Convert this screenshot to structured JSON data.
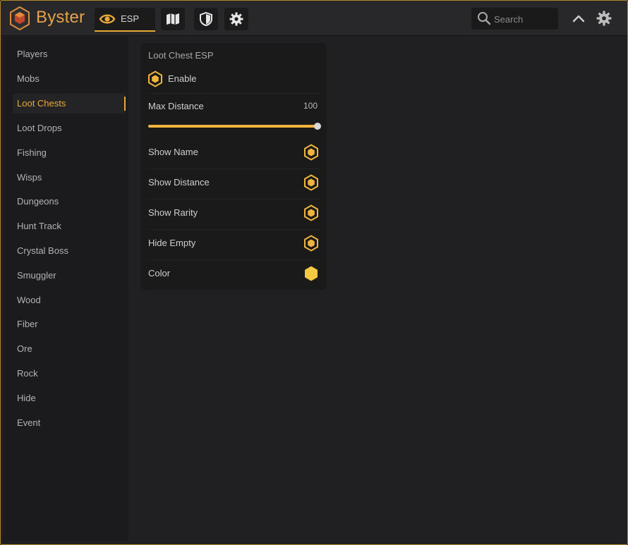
{
  "header": {
    "brand": "Byster",
    "tabs": {
      "esp": "ESP"
    },
    "search": {
      "placeholder": "Search",
      "value": ""
    }
  },
  "sidebar": {
    "items": [
      {
        "label": "Players",
        "active": false
      },
      {
        "label": "Mobs",
        "active": false
      },
      {
        "label": "Loot Chests",
        "active": true
      },
      {
        "label": "Loot Drops",
        "active": false
      },
      {
        "label": "Fishing",
        "active": false
      },
      {
        "label": "Wisps",
        "active": false
      },
      {
        "label": "Dungeons",
        "active": false
      },
      {
        "label": "Hunt Track",
        "active": false
      },
      {
        "label": "Crystal Boss",
        "active": false
      },
      {
        "label": "Smuggler",
        "active": false
      },
      {
        "label": "Wood",
        "active": false
      },
      {
        "label": "Fiber",
        "active": false
      },
      {
        "label": "Ore",
        "active": false
      },
      {
        "label": "Rock",
        "active": false
      },
      {
        "label": "Hide",
        "active": false
      },
      {
        "label": "Event",
        "active": false
      }
    ]
  },
  "panel": {
    "title": "Loot Chest ESP",
    "enable_label": "Enable",
    "enable_checked": true,
    "max_distance": {
      "label": "Max Distance",
      "value": "100",
      "fraction": 1.0
    },
    "options": [
      {
        "label": "Show Name",
        "checked": true
      },
      {
        "label": "Show Distance",
        "checked": true
      },
      {
        "label": "Show Rarity",
        "checked": true
      },
      {
        "label": "Hide Empty",
        "checked": true
      }
    ],
    "color_label": "Color",
    "color_value": "#f5c842"
  },
  "theme": {
    "accent": "#e8a838",
    "border": "#b0892e"
  }
}
